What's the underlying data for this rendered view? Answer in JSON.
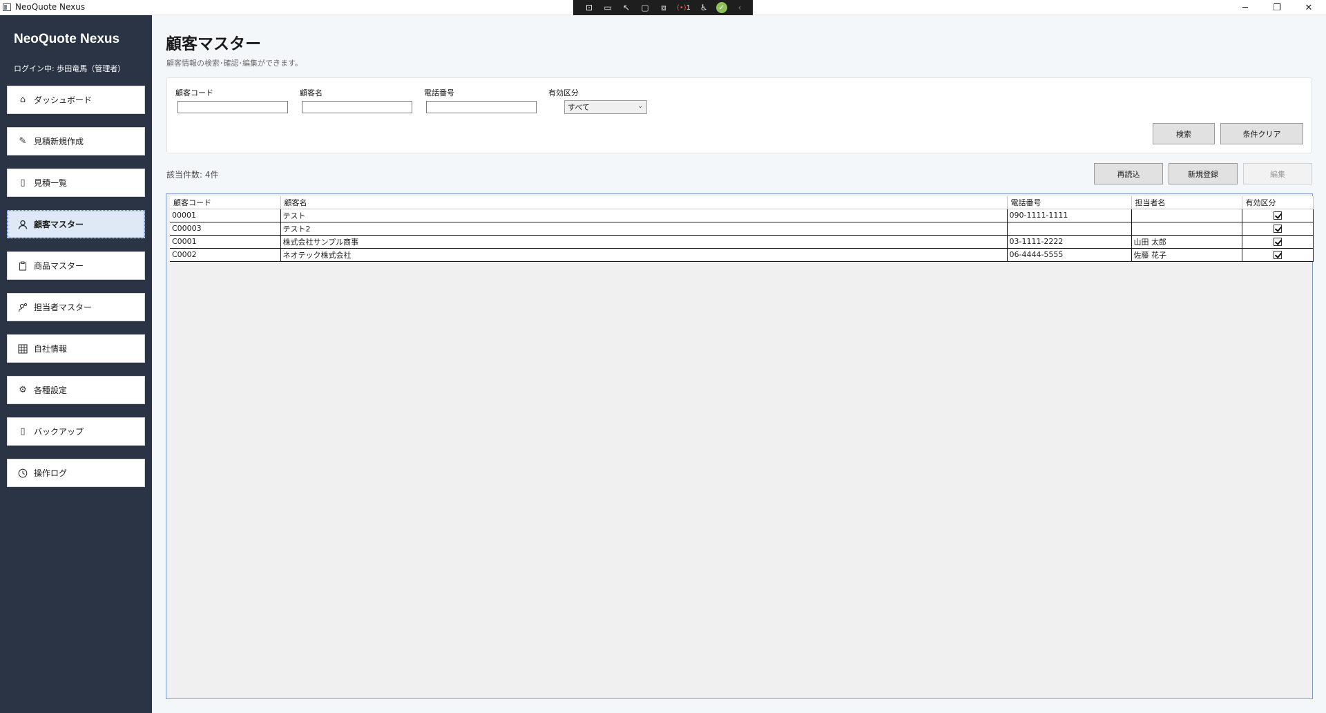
{
  "window": {
    "title": "NeoQuote Nexus",
    "minimize_glyph": "─",
    "maximize_glyph": "❐",
    "close_glyph": "✕"
  },
  "debug_toolbar": {
    "items": [
      "select-element-icon",
      "video-icon",
      "pointer-icon",
      "layout-icon",
      "display-layout-icon",
      "binding-failures-icon",
      "accessibility-icon",
      "ok-icon",
      "collapse-icon"
    ],
    "binding_count": "1"
  },
  "sidebar": {
    "brand": "NeoQuote Nexus",
    "login": "ログイン中: 歩田竜馬（管理者）",
    "items": [
      {
        "label": "ダッシュボード",
        "icon": "home-icon"
      },
      {
        "label": "見積新規作成",
        "icon": "pencil-icon"
      },
      {
        "label": "見積一覧",
        "icon": "document-icon"
      },
      {
        "label": "顧客マスター",
        "icon": "person-icon"
      },
      {
        "label": "商品マスター",
        "icon": "clipboard-icon"
      },
      {
        "label": "担当者マスター",
        "icon": "staff-icon"
      },
      {
        "label": "自社情報",
        "icon": "grid-icon"
      },
      {
        "label": "各種設定",
        "icon": "gear-icon"
      },
      {
        "label": "バックアップ",
        "icon": "backup-icon"
      },
      {
        "label": "操作ログ",
        "icon": "clock-icon"
      }
    ],
    "active_index": 3
  },
  "page": {
    "title": "顧客マスター",
    "subtitle": "顧客情報の検索･確認･編集ができます。"
  },
  "filters": {
    "customer_code_label": "顧客コード",
    "customer_code_value": "",
    "customer_name_label": "顧客名",
    "customer_name_value": "",
    "phone_label": "電話番号",
    "phone_value": "",
    "valid_label": "有効区分",
    "valid_selected": "すべて",
    "search_button": "検索",
    "clear_button": "条件クリア"
  },
  "result": {
    "count_text": "該当件数: 4件",
    "reload_button": "再読込",
    "new_button": "新規登録",
    "edit_button": "編集"
  },
  "table": {
    "columns": [
      "顧客コード",
      "顧客名",
      "電話番号",
      "担当者名",
      "有効区分"
    ],
    "rows": [
      {
        "code": "00001",
        "name": "テスト",
        "phone": "090-1111-1111",
        "staff": "",
        "valid": true
      },
      {
        "code": "C00003",
        "name": "テスト2",
        "phone": "",
        "staff": "",
        "valid": true
      },
      {
        "code": "C0001",
        "name": "株式会社サンプル商事",
        "phone": "03-1111-2222",
        "staff": "山田 太郎",
        "valid": true
      },
      {
        "code": "C0002",
        "name": "ネオテック株式会社",
        "phone": "06-4444-5555",
        "staff": "佐藤 花子",
        "valid": true
      }
    ]
  },
  "colors": {
    "sidebar_bg": "#2b3445",
    "main_bg": "#f4f7fa",
    "active_nav_bg": "#dfe8f5",
    "grid_border": "#7a9cc6"
  }
}
